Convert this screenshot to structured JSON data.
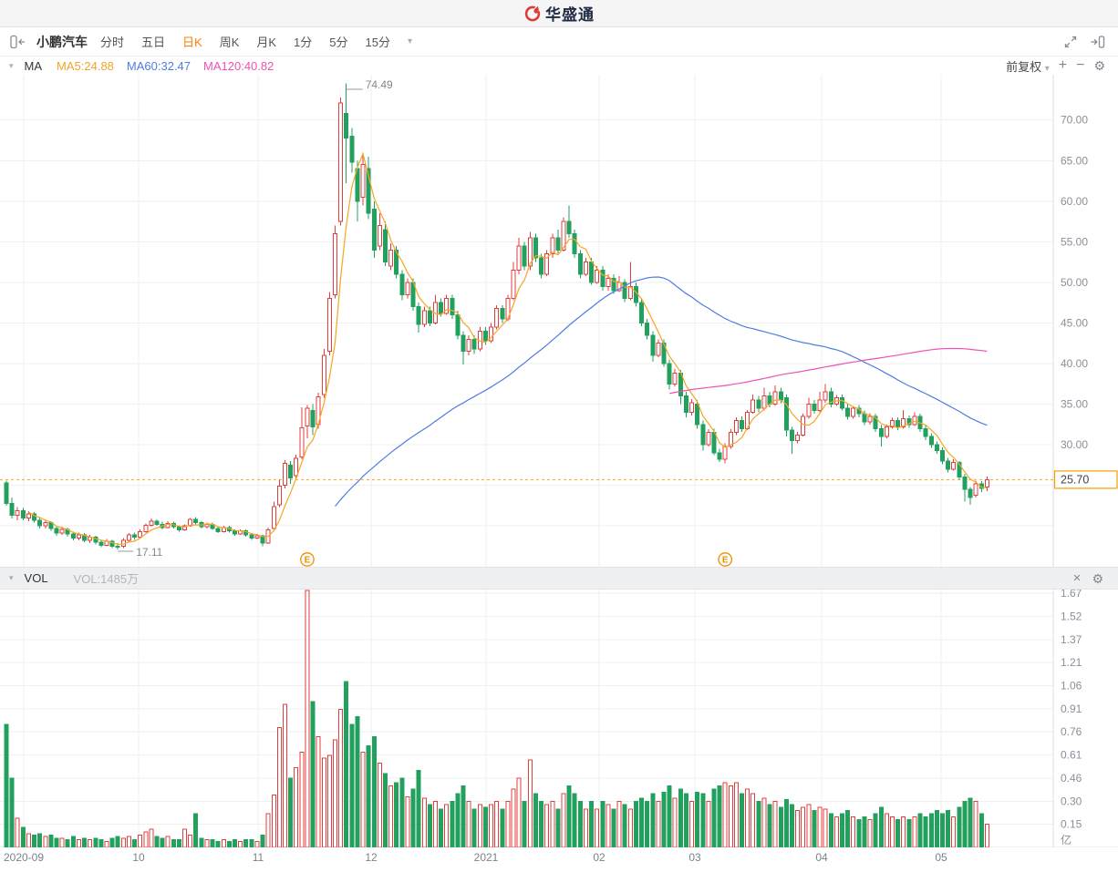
{
  "header": {
    "logo": "华盛通"
  },
  "toolbar": {
    "symbol": "小鹏汽车",
    "tabs": [
      {
        "label": "分时",
        "active": false
      },
      {
        "label": "五日",
        "active": false
      },
      {
        "label": "日K",
        "active": true
      },
      {
        "label": "周K",
        "active": false
      },
      {
        "label": "月K",
        "active": false
      },
      {
        "label": "1分",
        "active": false
      },
      {
        "label": "5分",
        "active": false
      },
      {
        "label": "15分",
        "active": false
      }
    ],
    "more_caret": "▾"
  },
  "indicator_bar": {
    "caret": "▾",
    "group_label": "MA",
    "items": [
      {
        "label": "MA5:24.88",
        "color": "#f5a22d"
      },
      {
        "label": "MA60:32.47",
        "color": "#4d7de2"
      },
      {
        "label": "MA120:40.82",
        "color": "#ee52b5"
      }
    ],
    "adjust_label": "前复权",
    "zoom_in": "+",
    "zoom_out": "−",
    "settings_icon": "⚙"
  },
  "vol_bar": {
    "caret": "▾",
    "label": "VOL",
    "value": "VOL:1485万",
    "close_icon": "×",
    "settings_icon": "⚙"
  },
  "colors": {
    "up": "#e23e3e",
    "down": "#22a05e",
    "ma5": "#f5a623",
    "ma60": "#4d7de2",
    "ma120": "#ee52b5",
    "grid": "#efefef",
    "axis_border": "#dcdcdf",
    "axis_text": "#8a8f98",
    "current_line": "#f5a623",
    "current_box": "#f59f00",
    "marker": "#f08c00",
    "annotation": "#888888"
  },
  "chart_data": {
    "type": "candlestick",
    "symbol": "小鹏汽车",
    "timeframe": "日K",
    "price_axis": {
      "ticks": [
        "70.00",
        "65.00",
        "60.00",
        "55.00",
        "50.00",
        "45.00",
        "40.00",
        "35.00",
        "30.00"
      ],
      "tick_values": [
        70,
        65,
        60,
        55,
        50,
        45,
        40,
        35,
        30
      ],
      "grid_values": [
        70,
        65,
        60,
        55,
        50,
        45,
        40,
        35,
        30,
        25,
        20
      ],
      "current_price": "25.70",
      "current_value": 25.7
    },
    "volume_axis": {
      "ticks": [
        "1.67",
        "1.52",
        "1.37",
        "1.21",
        "1.06",
        "0.91",
        "0.76",
        "0.61",
        "0.46",
        "0.30",
        "0.15"
      ],
      "unit": "亿",
      "max": 1.675
    },
    "x_axis": {
      "labels": [
        "2020-09",
        "10",
        "11",
        "12",
        "2021",
        "02",
        "03",
        "04",
        "05"
      ],
      "positions": [
        26,
        152,
        283,
        407,
        533,
        657,
        762,
        901,
        1032
      ]
    },
    "annotations": {
      "high": {
        "label": "74.49",
        "index": 61
      },
      "low": {
        "label": "17.11",
        "index": 20
      }
    },
    "event_markers": [
      {
        "label": "E",
        "index": 54
      },
      {
        "label": "E",
        "index": 129
      }
    ],
    "ma_lines": [
      {
        "period": 5,
        "color": "#f5a623"
      },
      {
        "period": 60,
        "color": "#4d7de2"
      },
      {
        "period": 120,
        "color": "#ee52b5"
      }
    ],
    "candles": [
      [
        25.3,
        25.6,
        22.5,
        22.8,
        0.8
      ],
      [
        22.8,
        23.5,
        20.9,
        21.3,
        0.45
      ],
      [
        21.3,
        22.3,
        20.7,
        21.9,
        0.19
      ],
      [
        21.9,
        22.2,
        20.7,
        21.0,
        0.13
      ],
      [
        21.0,
        21.8,
        20.6,
        21.5,
        0.09
      ],
      [
        21.5,
        21.7,
        20.4,
        20.7,
        0.08
      ],
      [
        20.7,
        21.0,
        19.7,
        20.0,
        0.09
      ],
      [
        20.0,
        20.7,
        19.7,
        20.4,
        0.07
      ],
      [
        20.4,
        20.6,
        19.4,
        19.7,
        0.08
      ],
      [
        19.7,
        19.9,
        18.8,
        19.1,
        0.06
      ],
      [
        19.1,
        19.9,
        18.9,
        19.6,
        0.06
      ],
      [
        19.6,
        19.8,
        18.7,
        19.0,
        0.05
      ],
      [
        19.0,
        19.3,
        18.2,
        18.5,
        0.07
      ],
      [
        18.5,
        19.2,
        18.2,
        18.9,
        0.05
      ],
      [
        18.9,
        19.1,
        18.0,
        18.2,
        0.06
      ],
      [
        18.2,
        18.9,
        17.9,
        18.6,
        0.05
      ],
      [
        18.6,
        18.8,
        17.7,
        18.0,
        0.06
      ],
      [
        18.0,
        18.3,
        17.4,
        17.6,
        0.05
      ],
      [
        17.6,
        18.4,
        17.5,
        18.1,
        0.04
      ],
      [
        18.1,
        18.3,
        17.3,
        17.5,
        0.06
      ],
      [
        17.5,
        17.9,
        17.11,
        17.4,
        0.07
      ],
      [
        17.5,
        18.5,
        17.3,
        18.2,
        0.06
      ],
      [
        18.2,
        19.1,
        18.0,
        18.9,
        0.07
      ],
      [
        18.9,
        19.2,
        18.3,
        18.6,
        0.05
      ],
      [
        18.6,
        19.6,
        18.5,
        19.3,
        0.08
      ],
      [
        19.3,
        20.3,
        19.2,
        20.1,
        0.1
      ],
      [
        20.1,
        20.9,
        19.9,
        20.6,
        0.12
      ],
      [
        20.6,
        20.8,
        20.0,
        20.2,
        0.07
      ],
      [
        20.2,
        20.5,
        19.6,
        19.8,
        0.06
      ],
      [
        19.8,
        20.6,
        19.7,
        20.3,
        0.07
      ],
      [
        20.3,
        20.5,
        19.7,
        19.9,
        0.05
      ],
      [
        19.9,
        20.1,
        19.3,
        19.5,
        0.05
      ],
      [
        19.5,
        20.2,
        19.4,
        20.0,
        0.12
      ],
      [
        20.0,
        21.0,
        19.9,
        20.8,
        0.08
      ],
      [
        20.8,
        21.1,
        20.2,
        20.4,
        0.22
      ],
      [
        20.4,
        20.6,
        19.7,
        19.9,
        0.06
      ],
      [
        19.9,
        20.4,
        19.7,
        20.2,
        0.05
      ],
      [
        20.2,
        20.4,
        19.5,
        19.7,
        0.05
      ],
      [
        19.7,
        19.9,
        19.1,
        19.3,
        0.04
      ],
      [
        19.3,
        20.0,
        19.2,
        19.8,
        0.05
      ],
      [
        19.8,
        20.0,
        19.2,
        19.4,
        0.04
      ],
      [
        19.4,
        19.6,
        18.8,
        19.0,
        0.05
      ],
      [
        19.0,
        19.6,
        18.9,
        19.4,
        0.04
      ],
      [
        19.4,
        19.6,
        18.7,
        18.9,
        0.05
      ],
      [
        18.9,
        19.1,
        18.3,
        18.5,
        0.05
      ],
      [
        18.5,
        19.0,
        18.4,
        18.8,
        0.04
      ],
      [
        18.8,
        18.9,
        17.5,
        17.9,
        0.08
      ],
      [
        17.9,
        19.8,
        17.8,
        19.5,
        0.22
      ],
      [
        19.7,
        23.0,
        19.6,
        22.4,
        0.34
      ],
      [
        22.6,
        25.7,
        22.3,
        24.9,
        0.78
      ],
      [
        25.0,
        28.1,
        24.6,
        27.7,
        0.93
      ],
      [
        27.5,
        28.0,
        25.2,
        25.9,
        0.45
      ],
      [
        26.2,
        28.8,
        25.8,
        28.3,
        0.52
      ],
      [
        28.5,
        34.6,
        28.2,
        32.1,
        0.62
      ],
      [
        32.3,
        34.9,
        30.8,
        34.5,
        1.7
      ],
      [
        34.2,
        35.0,
        31.2,
        32.2,
        0.95
      ],
      [
        32.5,
        36.4,
        32.0,
        35.9,
        0.72
      ],
      [
        36.2,
        41.8,
        35.8,
        41.0,
        0.58
      ],
      [
        41.5,
        48.8,
        41.0,
        48.0,
        0.6
      ],
      [
        48.5,
        57.0,
        48.0,
        56.0,
        0.7
      ],
      [
        57.5,
        72.8,
        57.0,
        72.1,
        0.9
      ],
      [
        70.8,
        74.49,
        62.2,
        67.8,
        1.08
      ],
      [
        68.0,
        69.0,
        63.5,
        64.8,
        0.8
      ],
      [
        64.0,
        65.0,
        57.5,
        60.0,
        0.85
      ],
      [
        60.5,
        66.0,
        59.5,
        64.5,
        0.62
      ],
      [
        64.0,
        65.5,
        57.8,
        58.5,
        0.66
      ],
      [
        59.0,
        60.0,
        53.0,
        54.0,
        0.72
      ],
      [
        54.5,
        58.5,
        54.0,
        57.0,
        0.55
      ],
      [
        56.5,
        57.5,
        52.0,
        52.5,
        0.48
      ],
      [
        52.0,
        54.8,
        51.5,
        54.0,
        0.4
      ],
      [
        54.0,
        54.5,
        50.5,
        51.0,
        0.42
      ],
      [
        51.0,
        51.5,
        47.8,
        48.5,
        0.45
      ],
      [
        48.5,
        50.5,
        48.0,
        50.0,
        0.33
      ],
      [
        50.0,
        50.5,
        46.5,
        47.0,
        0.38
      ],
      [
        47.0,
        47.5,
        43.8,
        44.8,
        0.5
      ],
      [
        44.8,
        47.0,
        44.5,
        46.5,
        0.32
      ],
      [
        46.5,
        47.0,
        44.6,
        45.0,
        0.28
      ],
      [
        45.0,
        48.5,
        44.8,
        47.5,
        0.3
      ],
      [
        47.5,
        48.0,
        45.8,
        46.2,
        0.25
      ],
      [
        46.2,
        48.5,
        46.0,
        48.0,
        0.28
      ],
      [
        48.0,
        48.5,
        45.5,
        46.0,
        0.3
      ],
      [
        46.0,
        46.5,
        43.0,
        43.5,
        0.35
      ],
      [
        43.5,
        44.0,
        39.9,
        41.5,
        0.4
      ],
      [
        41.5,
        43.5,
        41.0,
        43.0,
        0.3
      ],
      [
        43.0,
        43.5,
        41.2,
        41.8,
        0.25
      ],
      [
        41.8,
        44.5,
        41.5,
        44.0,
        0.28
      ],
      [
        44.0,
        44.5,
        42.3,
        42.8,
        0.26
      ],
      [
        42.8,
        45.0,
        42.5,
        44.5,
        0.28
      ],
      [
        44.5,
        47.2,
        44.2,
        46.8,
        0.3
      ],
      [
        46.8,
        47.2,
        45.0,
        45.5,
        0.25
      ],
      [
        45.5,
        48.5,
        45.2,
        48.0,
        0.3
      ],
      [
        48.0,
        52.5,
        47.8,
        51.5,
        0.38
      ],
      [
        51.5,
        55.5,
        51.0,
        54.5,
        0.45
      ],
      [
        54.5,
        55.0,
        51.5,
        52.0,
        0.3
      ],
      [
        52.0,
        56.2,
        51.5,
        55.5,
        0.57
      ],
      [
        55.5,
        56.0,
        52.5,
        53.0,
        0.35
      ],
      [
        53.0,
        53.5,
        50.5,
        51.0,
        0.3
      ],
      [
        51.0,
        54.0,
        50.8,
        53.5,
        0.28
      ],
      [
        53.5,
        56.0,
        53.0,
        55.5,
        0.3
      ],
      [
        55.5,
        56.5,
        53.5,
        54.0,
        0.25
      ],
      [
        54.0,
        58.0,
        53.8,
        57.5,
        0.35
      ],
      [
        57.5,
        59.5,
        55.5,
        56.0,
        0.4
      ],
      [
        56.0,
        56.5,
        53.0,
        53.5,
        0.35
      ],
      [
        53.5,
        54.0,
        50.5,
        51.0,
        0.3
      ],
      [
        51.0,
        53.0,
        50.8,
        52.5,
        0.25
      ],
      [
        52.5,
        53.0,
        49.7,
        50.0,
        0.3
      ],
      [
        50.0,
        52.0,
        49.8,
        51.5,
        0.25
      ],
      [
        51.5,
        52.0,
        49.0,
        49.5,
        0.3
      ],
      [
        49.5,
        51.0,
        49.0,
        50.5,
        0.28
      ],
      [
        50.5,
        51.0,
        48.6,
        49.0,
        0.25
      ],
      [
        49.0,
        50.8,
        48.8,
        50.0,
        0.3
      ],
      [
        50.0,
        50.4,
        47.6,
        48.0,
        0.28
      ],
      [
        48.0,
        52.5,
        47.8,
        49.5,
        0.25
      ],
      [
        49.5,
        50.0,
        47.0,
        47.5,
        0.3
      ],
      [
        47.5,
        48.0,
        44.6,
        45.0,
        0.32
      ],
      [
        45.0,
        45.5,
        43.0,
        43.5,
        0.3
      ],
      [
        43.5,
        44.0,
        40.2,
        41.0,
        0.35
      ],
      [
        41.0,
        43.0,
        40.8,
        42.5,
        0.3
      ],
      [
        42.5,
        43.0,
        39.6,
        40.0,
        0.36
      ],
      [
        40.0,
        40.5,
        36.8,
        37.5,
        0.4
      ],
      [
        37.5,
        39.3,
        37.2,
        38.8,
        0.32
      ],
      [
        38.8,
        39.2,
        35.0,
        36.0,
        0.38
      ],
      [
        36.0,
        36.5,
        33.4,
        34.0,
        0.35
      ],
      [
        34.0,
        35.6,
        33.6,
        35.2,
        0.3
      ],
      [
        35.0,
        35.5,
        32.0,
        32.5,
        0.36
      ],
      [
        32.5,
        33.0,
        29.3,
        30.0,
        0.35
      ],
      [
        30.0,
        31.9,
        29.8,
        31.5,
        0.3
      ],
      [
        31.5,
        32.0,
        28.7,
        29.0,
        0.38
      ],
      [
        29.0,
        29.5,
        27.9,
        28.2,
        0.4
      ],
      [
        28.2,
        30.2,
        27.7,
        29.8,
        0.42
      ],
      [
        29.8,
        31.9,
        29.5,
        31.5,
        0.4
      ],
      [
        31.5,
        33.4,
        31.2,
        33.0,
        0.42
      ],
      [
        33.0,
        33.5,
        31.6,
        32.0,
        0.35
      ],
      [
        32.0,
        34.3,
        31.8,
        34.0,
        0.38
      ],
      [
        34.0,
        36.2,
        33.8,
        35.5,
        0.35
      ],
      [
        35.5,
        36.0,
        34.0,
        34.5,
        0.3
      ],
      [
        34.5,
        37.0,
        34.2,
        36.0,
        0.32
      ],
      [
        36.0,
        36.5,
        34.6,
        35.0,
        0.28
      ],
      [
        35.0,
        37.3,
        34.8,
        36.5,
        0.3
      ],
      [
        36.5,
        37.0,
        35.1,
        35.5,
        0.26
      ],
      [
        35.8,
        36.2,
        31.0,
        31.8,
        0.31
      ],
      [
        31.8,
        32.2,
        28.9,
        30.5,
        0.28
      ],
      [
        30.5,
        31.6,
        30.2,
        31.2,
        0.24
      ],
      [
        31.2,
        33.8,
        31.0,
        33.5,
        0.26
      ],
      [
        33.5,
        35.8,
        33.2,
        35.0,
        0.28
      ],
      [
        35.0,
        35.5,
        33.8,
        34.2,
        0.24
      ],
      [
        34.2,
        36.5,
        34.0,
        35.5,
        0.26
      ],
      [
        35.5,
        37.5,
        35.2,
        36.5,
        0.25
      ],
      [
        36.5,
        37.0,
        34.6,
        35.0,
        0.22
      ],
      [
        35.0,
        36.1,
        34.8,
        35.8,
        0.2
      ],
      [
        35.8,
        36.2,
        34.2,
        34.5,
        0.22
      ],
      [
        34.5,
        35.0,
        33.1,
        33.5,
        0.24
      ],
      [
        33.5,
        34.8,
        33.2,
        34.5,
        0.2
      ],
      [
        34.5,
        34.9,
        33.4,
        33.8,
        0.18
      ],
      [
        33.8,
        34.2,
        32.4,
        32.8,
        0.2
      ],
      [
        32.8,
        33.9,
        32.5,
        33.5,
        0.18
      ],
      [
        33.5,
        33.8,
        31.6,
        32.0,
        0.22
      ],
      [
        32.0,
        32.4,
        29.8,
        31.0,
        0.26
      ],
      [
        31.0,
        32.5,
        30.8,
        32.2,
        0.22
      ],
      [
        32.2,
        33.3,
        32.0,
        33.0,
        0.2
      ],
      [
        33.0,
        33.4,
        31.8,
        32.2,
        0.18
      ],
      [
        32.2,
        34.3,
        32.0,
        33.2,
        0.2
      ],
      [
        33.2,
        33.6,
        32.1,
        32.5,
        0.18
      ],
      [
        32.5,
        34.0,
        32.3,
        33.5,
        0.2
      ],
      [
        33.5,
        33.8,
        31.6,
        32.0,
        0.22
      ],
      [
        32.0,
        32.4,
        30.6,
        31.0,
        0.2
      ],
      [
        31.0,
        31.4,
        29.6,
        30.0,
        0.22
      ],
      [
        30.0,
        30.4,
        28.9,
        29.3,
        0.24
      ],
      [
        29.3,
        29.7,
        27.6,
        28.0,
        0.22
      ],
      [
        28.0,
        28.4,
        26.6,
        27.0,
        0.24
      ],
      [
        27.0,
        28.2,
        26.8,
        27.8,
        0.2
      ],
      [
        27.8,
        28.0,
        25.7,
        26.0,
        0.26
      ],
      [
        26.0,
        26.4,
        23.0,
        24.5,
        0.3
      ],
      [
        24.5,
        24.8,
        22.6,
        23.5,
        0.32
      ],
      [
        23.8,
        25.6,
        23.5,
        25.2,
        0.3
      ],
      [
        25.2,
        25.5,
        24.2,
        24.6,
        0.22
      ],
      [
        24.8,
        26.1,
        24.3,
        25.7,
        0.15
      ]
    ]
  }
}
